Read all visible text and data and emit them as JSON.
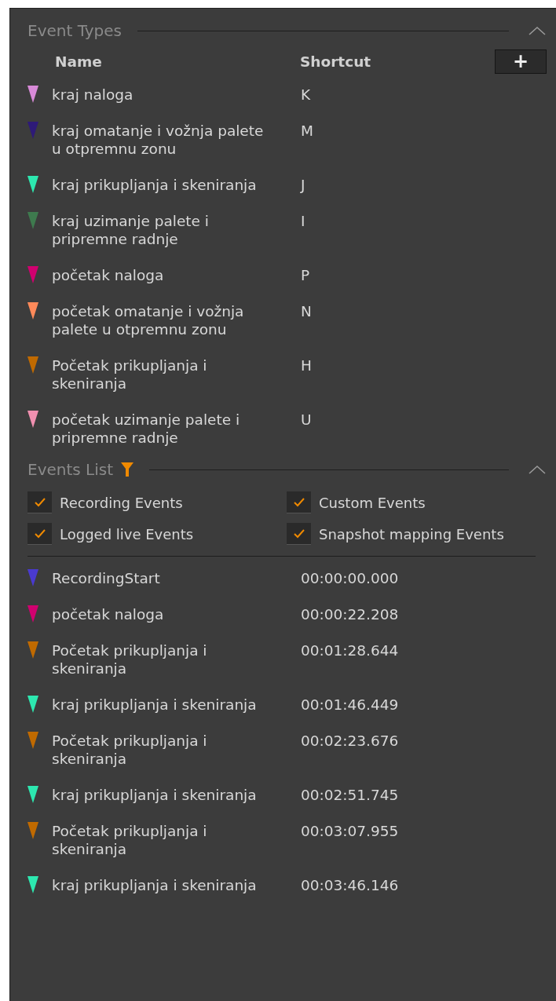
{
  "event_types": {
    "title": "Event Types",
    "expanded": true,
    "columns": [
      "Name",
      "Shortcut"
    ],
    "add_button": "+",
    "items": [
      {
        "name": "kraj naloga",
        "shortcut": "K",
        "color": "#d88ad8"
      },
      {
        "name": "kraj omatanje i vožnja palete u otpremnu zonu",
        "shortcut": "M",
        "color": "#2e1a78"
      },
      {
        "name": "kraj prikupljanja i skeniranja",
        "shortcut": "J",
        "color": "#2de8b0"
      },
      {
        "name": "kraj uzimanje palete i pripremne radnje",
        "shortcut": "I",
        "color": "#3e7a4e"
      },
      {
        "name": "početak naloga",
        "shortcut": "P",
        "color": "#d0006f"
      },
      {
        "name": "početak omatanje i vožnja palete u otpremnu zonu",
        "shortcut": "N",
        "color": "#ff8a5a"
      },
      {
        "name": "Početak prikupljanja i skeniranja",
        "shortcut": "H",
        "color": "#c06a00"
      },
      {
        "name": "početak uzimanje palete i pripremne radnje",
        "shortcut": "U",
        "color": "#f090b0"
      }
    ]
  },
  "events_list": {
    "title": "Events List",
    "expanded": true,
    "filters": [
      {
        "label": "Recording Events",
        "checked": true
      },
      {
        "label": "Custom Events",
        "checked": true
      },
      {
        "label": "Logged live Events",
        "checked": true
      },
      {
        "label": "Snapshot mapping Events",
        "checked": true
      }
    ],
    "events": [
      {
        "name": "RecordingStart",
        "time": "00:00:00.000",
        "color": "#4a3ad0"
      },
      {
        "name": "početak naloga",
        "time": "00:00:22.208",
        "color": "#d0006f"
      },
      {
        "name": "Početak prikupljanja i skeniranja",
        "time": "00:01:28.644",
        "color": "#c06a00"
      },
      {
        "name": "kraj prikupljanja i skeniranja",
        "time": "00:01:46.449",
        "color": "#2de8b0"
      },
      {
        "name": "Početak prikupljanja i skeniranja",
        "time": "00:02:23.676",
        "color": "#c06a00"
      },
      {
        "name": "kraj prikupljanja i skeniranja",
        "time": "00:02:51.745",
        "color": "#2de8b0"
      },
      {
        "name": "Početak prikupljanja i skeniranja",
        "time": "00:03:07.955",
        "color": "#c06a00"
      },
      {
        "name": "kraj prikupljanja i skeniranja",
        "time": "00:03:46.146",
        "color": "#2de8b0"
      }
    ]
  }
}
